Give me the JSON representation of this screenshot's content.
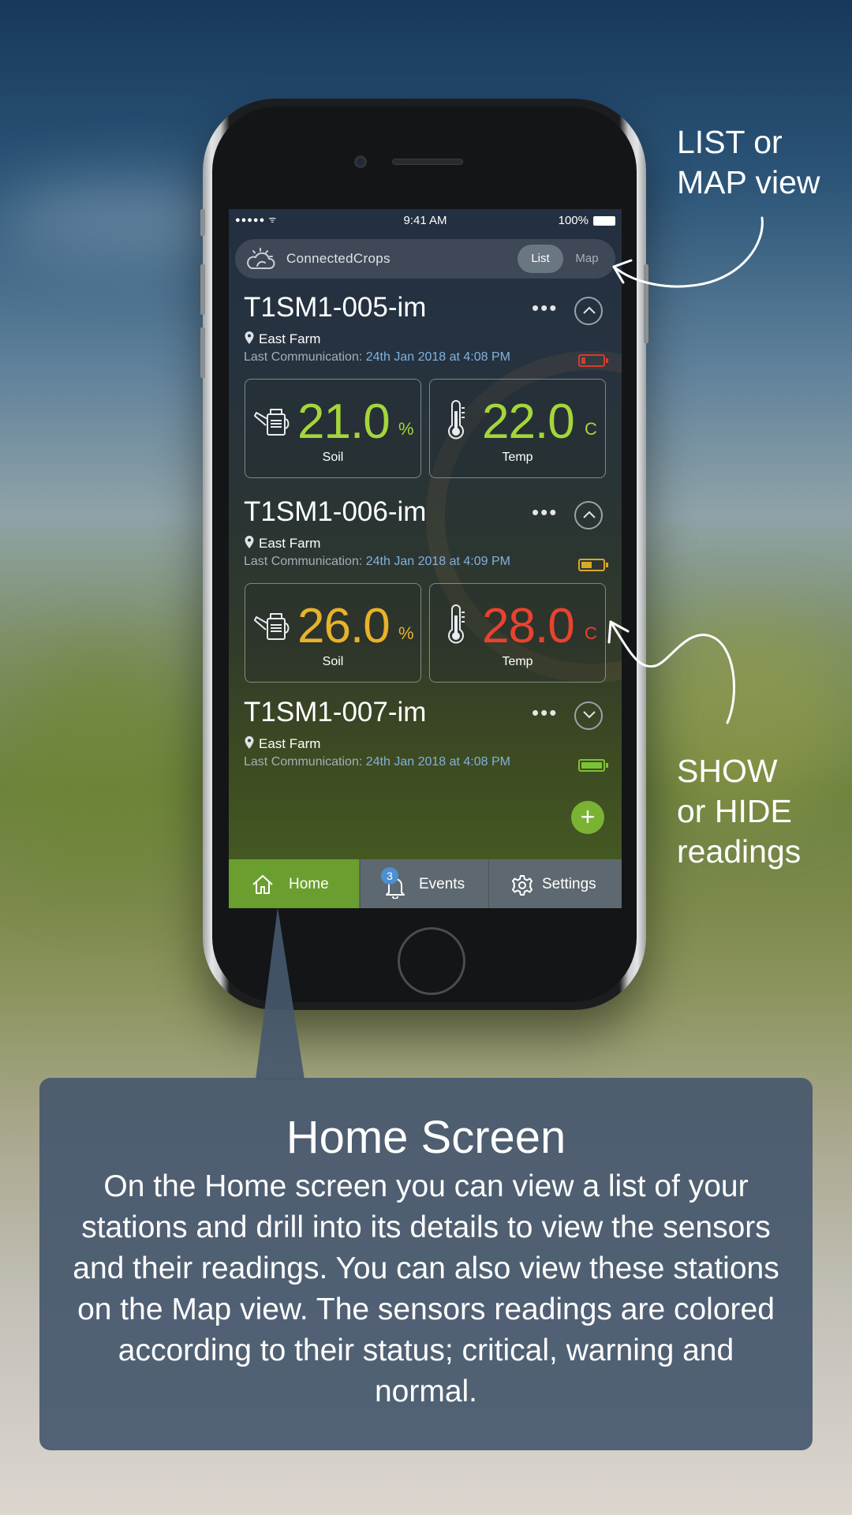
{
  "status_bar": {
    "signal": "●●●●● ᯤ",
    "time": "9:41 AM",
    "battery": "100%"
  },
  "header": {
    "brand": "ConnectedCrops",
    "view_list": "List",
    "view_map": "Map"
  },
  "stations": [
    {
      "name": "T1SM1-005-im",
      "more": "•••",
      "farm": "East Farm",
      "last_comm_label": "Last Communication: ",
      "last_comm_date": "24th Jan 2018 at 4:08 PM",
      "battery_status": "critical",
      "battery_color": "#d63c2e",
      "battery_fill": 0.2,
      "expanded": true,
      "readings": [
        {
          "label": "Soil",
          "value": "21.0",
          "unit": "%",
          "color": "#a4d63a",
          "icon": "watering-can-icon"
        },
        {
          "label": "Temp",
          "value": "22.0",
          "unit": "C",
          "color": "#a4d63a",
          "icon": "thermometer-icon"
        }
      ]
    },
    {
      "name": "T1SM1-006-im",
      "more": "•••",
      "farm": "East Farm",
      "last_comm_label": "Last Communication: ",
      "last_comm_date": "24th Jan 2018 at 4:09 PM",
      "battery_status": "warning",
      "battery_color": "#d9a827",
      "battery_fill": 0.5,
      "expanded": true,
      "readings": [
        {
          "label": "Soil",
          "value": "26.0",
          "unit": "%",
          "color": "#e8b22a",
          "icon": "watering-can-icon"
        },
        {
          "label": "Temp",
          "value": "28.0",
          "unit": "C",
          "color": "#e8432f",
          "icon": "thermometer-icon"
        }
      ]
    },
    {
      "name": "T1SM1-007-im",
      "more": "•••",
      "farm": "East Farm",
      "last_comm_label": "Last Communication: ",
      "last_comm_date": "24th Jan 2018 at 4:08 PM",
      "battery_status": "normal",
      "battery_color": "#7cc236",
      "battery_fill": 1.0,
      "expanded": false,
      "readings": []
    }
  ],
  "fab": "+",
  "tabs": {
    "home": "Home",
    "events": "Events",
    "events_badge": "3",
    "settings": "Settings"
  },
  "annotations": {
    "list_or_map": [
      "LIST or",
      "MAP view"
    ],
    "show_hide": [
      "SHOW",
      "or HIDE",
      "readings"
    ]
  },
  "callout": {
    "title": "Home Screen",
    "body": "On the Home screen you can view a list of your stations and drill into its details to view the sensors and their readings. You can also view these stations on the Map view. The sensors readings are colored according to their status; critical, warning and normal."
  },
  "colors": {
    "accent_green": "#6a9f2f",
    "badge_blue": "#4c8fd2",
    "callout_bg": "#465870"
  }
}
